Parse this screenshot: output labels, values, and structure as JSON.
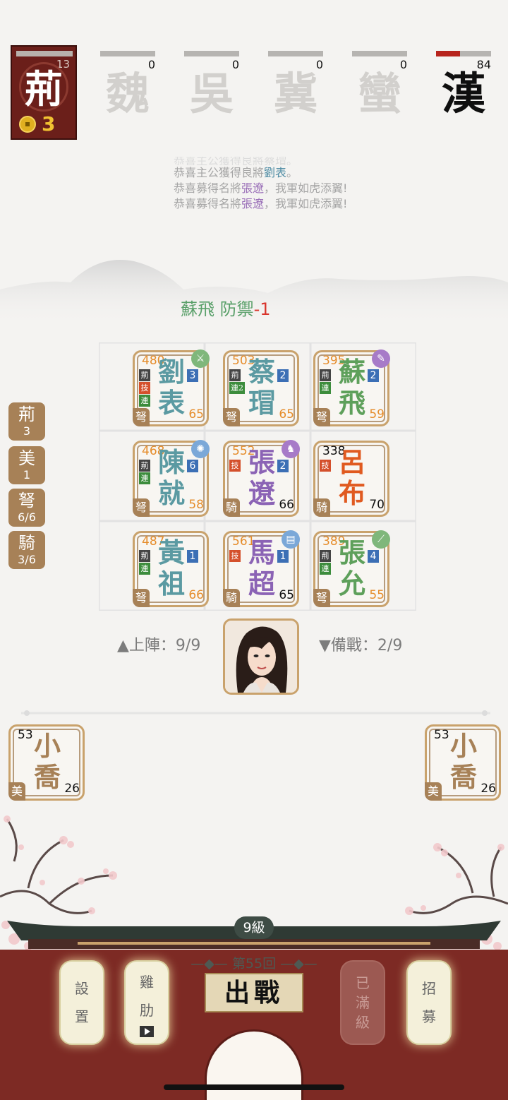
{
  "player_faction": {
    "name": "荊",
    "bar_value": "13",
    "coins": "3"
  },
  "rivals": [
    {
      "name": "魏",
      "value": "0"
    },
    {
      "name": "吳",
      "value": "0"
    },
    {
      "name": "冀",
      "value": "0"
    },
    {
      "name": "蠻",
      "value": "0"
    },
    {
      "name": "漢",
      "value": "84"
    }
  ],
  "log": {
    "line0": "恭喜主公獲得良將蔡瑁。",
    "line1_pre": "恭喜主公獲得良將",
    "line1_name": "劉表",
    "line1_post": "。",
    "line2_pre": "恭喜募得名將",
    "line2_name": "張遼",
    "line2_post": "，我軍如虎添翼!",
    "line3_pre": "恭喜募得名將",
    "line3_name": "張遼",
    "line3_post": "，我軍如虎添翼!"
  },
  "combat_msg": {
    "text": "蘇飛 防禦",
    "delta": "-1"
  },
  "grid_units": [
    {
      "hp": "480",
      "name_top": "劉",
      "name_bottom": "表",
      "level": "3",
      "atk": "65",
      "type": "弩",
      "tags": [
        "荊",
        "技",
        "連"
      ],
      "equip": "sword"
    },
    {
      "hp": "503",
      "name_top": "蔡",
      "name_bottom": "瑁",
      "level": "2",
      "atk": "65",
      "type": "弩",
      "tags": [
        "荊",
        "連2"
      ],
      "equip": ""
    },
    {
      "hp": "395",
      "name_top": "蘇",
      "name_bottom": "飛",
      "level": "2",
      "atk": "59",
      "type": "弩",
      "tags": [
        "荊",
        "連"
      ],
      "equip": "brush"
    },
    {
      "hp": "468",
      "name_top": "陳",
      "name_bottom": "就",
      "level": "6",
      "atk": "58",
      "type": "弩",
      "tags": [
        "荊",
        "連"
      ],
      "equip": "spark"
    },
    {
      "hp": "552",
      "name_top": "張",
      "name_bottom": "遼",
      "level": "2",
      "atk": "66",
      "type": "騎",
      "tags": [
        "技"
      ],
      "equip": "horse"
    },
    {
      "hp": "338",
      "name_top": "呂",
      "name_bottom": "布",
      "level": "",
      "atk": "70",
      "type": "騎",
      "tags": [
        "技"
      ],
      "equip": ""
    },
    {
      "hp": "487",
      "name_top": "黃",
      "name_bottom": "祖",
      "level": "1",
      "atk": "66",
      "type": "弩",
      "tags": [
        "荊",
        "連"
      ],
      "equip": ""
    },
    {
      "hp": "561",
      "name_top": "馬",
      "name_bottom": "超",
      "level": "1",
      "atk": "65",
      "type": "騎",
      "tags": [
        "技"
      ],
      "equip": "book"
    },
    {
      "hp": "389",
      "name_top": "張",
      "name_bottom": "允",
      "level": "4",
      "atk": "55",
      "type": "弩",
      "tags": [
        "荊",
        "連"
      ],
      "equip": "spear"
    }
  ],
  "deploy": {
    "on_field": "上陣：9/9",
    "reserve": "備戰：2/9"
  },
  "counters": [
    {
      "key": "荊",
      "value": "3"
    },
    {
      "key": "美",
      "value": "1"
    },
    {
      "key": "弩",
      "value": "6/6"
    },
    {
      "key": "騎",
      "value": "3/6"
    }
  ],
  "bench": [
    {
      "hp": "53",
      "name_top": "小",
      "name_bottom": "喬",
      "atk": "26",
      "type": "美"
    },
    {
      "hp": "53",
      "name_top": "小",
      "name_bottom": "喬",
      "atk": "26",
      "type": "美"
    }
  ],
  "bottom": {
    "level": "9級",
    "round": "第55回",
    "battle": "出戰",
    "settings": [
      "設",
      "置"
    ],
    "help": [
      "雞",
      "肋"
    ],
    "maxed": [
      "已",
      "滿",
      "級"
    ],
    "recruit": [
      "招",
      "募"
    ]
  }
}
